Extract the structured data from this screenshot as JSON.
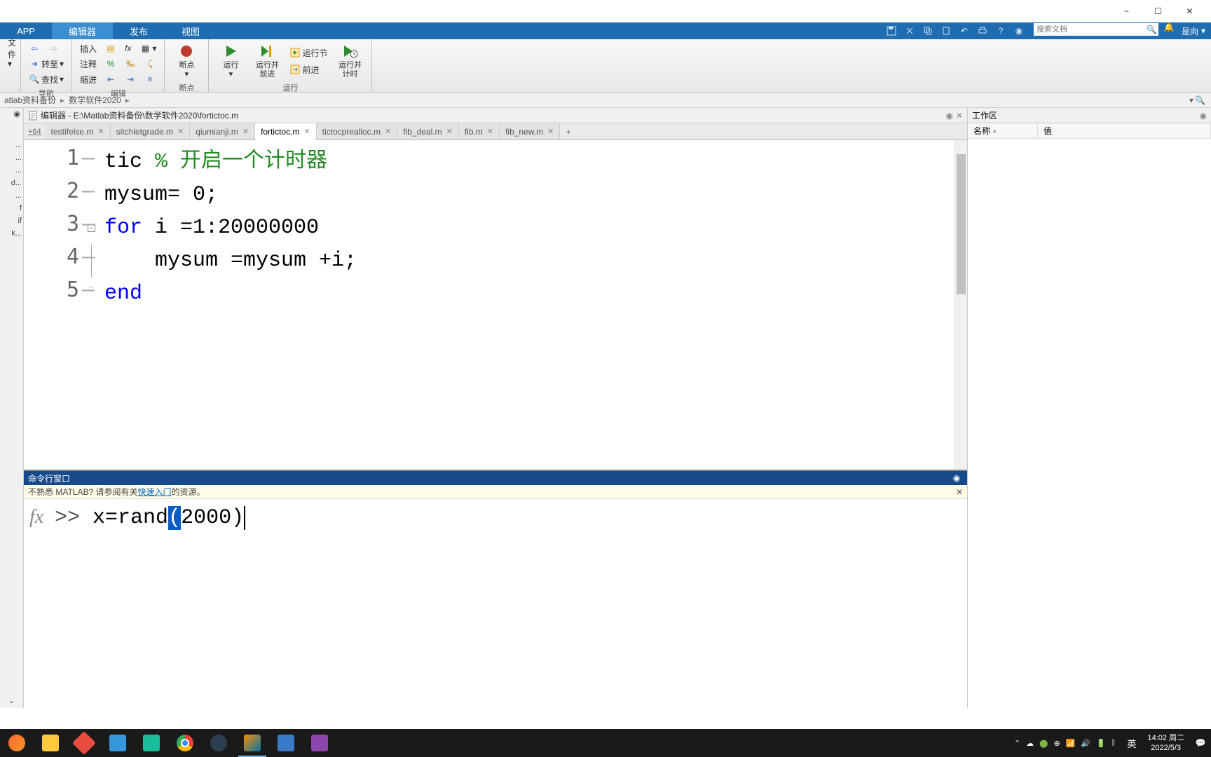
{
  "window": {
    "minimize": "−",
    "maximize": "☐",
    "close": "✕"
  },
  "ribbon": {
    "tabs": [
      "APP",
      "编辑器",
      "发布",
      "视图"
    ],
    "active_tab_index": 1,
    "search_placeholder": "搜索文档",
    "user_label": "是向"
  },
  "toolstrip": {
    "groups": {
      "file": {
        "label": "文件"
      },
      "nav": {
        "label": "导航",
        "goto": "转至",
        "find": "查找"
      },
      "edit": {
        "label": "编辑",
        "insert": "插入",
        "comment": "注释",
        "indent": "缩进",
        "fx": "fx"
      },
      "breakpoints": {
        "label": "断点",
        "button": "断点"
      },
      "run": {
        "label": "运行",
        "run": "运行",
        "run_advance": "运行并\n前进",
        "run_section": "运行节",
        "advance": "前进",
        "run_time": "运行并\n计时"
      }
    }
  },
  "breadcrumb": {
    "items": [
      "atlab资料备份",
      "数学软件2020"
    ]
  },
  "editor": {
    "title_prefix": "编辑器 - ",
    "file_path": "E:\\Matlab资料备份\\数学软件2020\\fortictoc.m",
    "overflow": "+64",
    "tabs": [
      {
        "name": "testifelse.m",
        "active": false
      },
      {
        "name": "sitchletgrade.m",
        "active": false
      },
      {
        "name": "qiumianji.m",
        "active": false
      },
      {
        "name": "fortictoc.m",
        "active": true
      },
      {
        "name": "tictocprealloc.m",
        "active": false
      },
      {
        "name": "fib_deal.m",
        "active": false
      },
      {
        "name": "fib.m",
        "active": false
      },
      {
        "name": "fib_new.m",
        "active": false
      }
    ],
    "code": {
      "line1": {
        "text": "tic ",
        "comment": "% 开启一个计时器"
      },
      "line2": "mysum= 0;",
      "line3": {
        "kw": "for",
        "rest": " i =1:20000000"
      },
      "line4": "    mysum =mysum +i;",
      "line5": {
        "kw": "end"
      }
    }
  },
  "left_gutter": {
    "items": [
      "...",
      "...",
      "...",
      "d...",
      "...",
      "f",
      "if",
      "k..."
    ]
  },
  "command": {
    "title": "命令行窗口",
    "info_prefix": "不熟悉 MATLAB? 请参阅有关",
    "info_link": "快速入门",
    "info_suffix": "的资源。",
    "prompt": ">> ",
    "input_before_hl": "x=rand",
    "input_hl": "(",
    "input_after_hl": "2000)"
  },
  "workspace": {
    "title": "工作区",
    "columns": [
      "名称",
      "值"
    ]
  },
  "taskbar": {
    "ime": "英",
    "time": "14:02 周二",
    "date": "2022/5/3"
  }
}
